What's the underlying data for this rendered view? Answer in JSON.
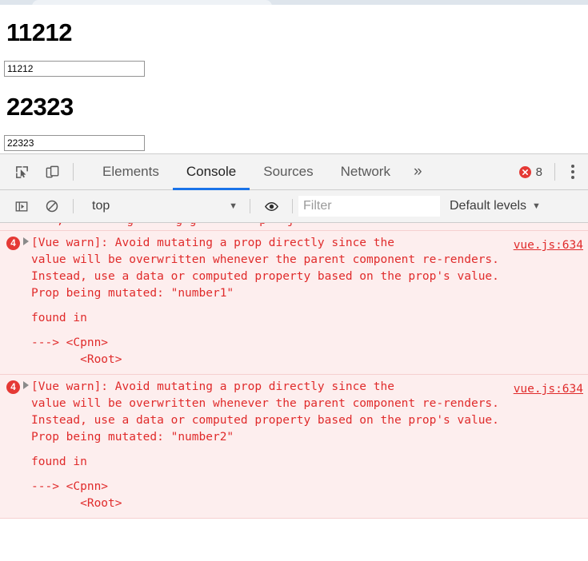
{
  "page": {
    "heading_1": "11212",
    "heading_2": "22323",
    "input_1_value": "11212",
    "input_2_value": "22323",
    "input_1_placeholder": "",
    "input_2_placeholder": ""
  },
  "devtools": {
    "left_icons": [
      {
        "name": "inspect-element-icon",
        "title": "Inspect element"
      },
      {
        "name": "device-toolbar-icon",
        "title": "Toggle device toolbar"
      }
    ],
    "tabs": [
      {
        "label": "Elements",
        "active": false
      },
      {
        "label": "Console",
        "active": true
      },
      {
        "label": "Sources",
        "active": false
      },
      {
        "label": "Network",
        "active": false
      }
    ],
    "more_tabs_label": "»",
    "error_count": "8",
    "kebab_label": "Customize and control DevTools",
    "console_toolbar": {
      "sidebar_toggle": "console-sidebar-icon",
      "clear_console": "clear-console-icon",
      "context_value": "top",
      "eye_icon": "live-expression-eye-icon",
      "filter_placeholder": "Filter",
      "filter_value": "",
      "levels_value": "Default levels"
    },
    "colors": {
      "error_red": "#e02b2b",
      "error_bg": "#fdeeee",
      "error_border": "#f6d0d0",
      "badge_red": "#e53935",
      "active_tab_underline": "#1a73e8",
      "toolbar_bg": "#f3f3f3"
    },
    "messages": [
      {
        "count": "4",
        "text": "[Vue warn]: Avoid mutating a prop directly since the\nvalue will be overwritten whenever the parent component re-renders.\nInstead, use a data or computed property based on the prop's value.\nProp being mutated: \"number1\"",
        "source": "vue.js:634",
        "found_in_label": "found in",
        "trace": "---> <Cpnn>\n       <Root>"
      },
      {
        "count": "4",
        "text": "[Vue warn]: Avoid mutating a prop directly since the\nvalue will be overwritten whenever the parent component re-renders.\nInstead, use a data or computed property based on the prop's value.\nProp being mutated: \"number2\"",
        "source": "vue.js:634",
        "found_in_label": "found in",
        "trace": "---> <Cpnn>\n       <Root>"
      }
    ]
  }
}
